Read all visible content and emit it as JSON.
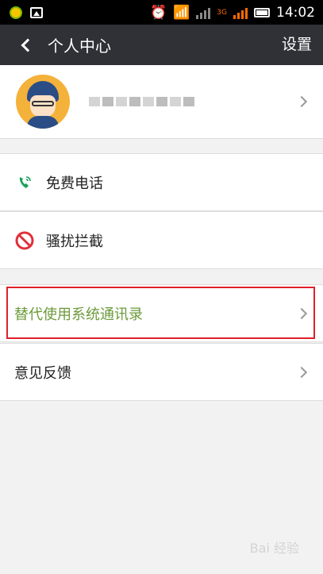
{
  "status_bar": {
    "time": "14:02",
    "network_label": "3G"
  },
  "header": {
    "title": "个人中心",
    "settings_label": "设置"
  },
  "profile": {
    "name": ""
  },
  "menu": {
    "free_call": "免费电话",
    "harassment_block": "骚扰拦截",
    "replace_contacts": "替代使用系统通讯录",
    "feedback": "意见反馈"
  },
  "watermark": "Bai 经验",
  "colors": {
    "header_bg": "#2f3136",
    "highlight_text": "#6b9a3a",
    "highlight_border": "#e0202a"
  }
}
